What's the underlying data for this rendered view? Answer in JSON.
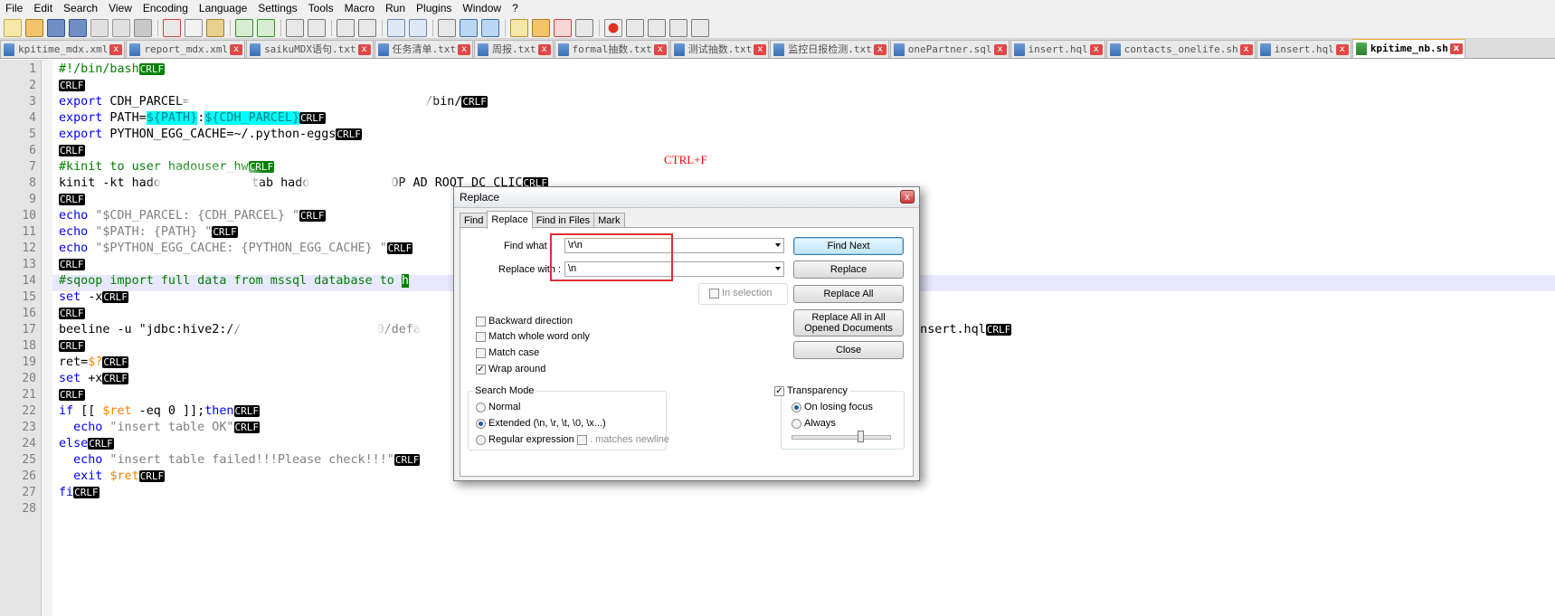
{
  "menu": [
    "File",
    "Edit",
    "Search",
    "View",
    "Encoding",
    "Language",
    "Settings",
    "Tools",
    "Macro",
    "Run",
    "Plugins",
    "Window",
    "?"
  ],
  "tabs": [
    {
      "label": "kpitime_mdx.xml",
      "active": false
    },
    {
      "label": "report_mdx.xml",
      "active": false
    },
    {
      "label": "saikuMDX语句.txt",
      "active": false
    },
    {
      "label": "任务清单.txt",
      "active": false
    },
    {
      "label": "周报.txt",
      "active": false
    },
    {
      "label": "formal抽数.txt",
      "active": false
    },
    {
      "label": "测试抽数.txt",
      "active": false
    },
    {
      "label": "监控日报检测.txt",
      "active": false
    },
    {
      "label": "onePartner.sql",
      "active": false
    },
    {
      "label": "insert.hql",
      "active": false
    },
    {
      "label": "contacts_onelife.sh",
      "active": false
    },
    {
      "label": "insert.hql",
      "active": false
    },
    {
      "label": "kpitime_nb.sh",
      "active": true
    }
  ],
  "line_numbers": [
    "1",
    "2",
    "3",
    "4",
    "5",
    "6",
    "7",
    "8",
    "9",
    "10",
    "11",
    "12",
    "13",
    "14",
    "15",
    "16",
    "17",
    "18",
    "19",
    "20",
    "21",
    "22",
    "23",
    "24",
    "25",
    "26",
    "27",
    "28"
  ],
  "code": {
    "eol": "CRLF",
    "l1": "#!/bin/bash",
    "l3a": "export",
    "l3b": " CDH_PARCEL=",
    "l3c": "/bin/",
    "l4a": "export",
    "l4b": " PATH=",
    "l4c": "${PATH}",
    "l4d": ":",
    "l4e": "${CDH_PARCEL}",
    "l5a": "export",
    "l5b": " PYTHON_EGG_CACHE=~/.python-eggs",
    "l7": "#kinit to user hadouser_hw",
    "l8a": "kinit -kt hado",
    "l8b": "tab hado",
    "l8c": "OP AD ROOT DC CLIC",
    "l10a": "echo",
    "l10b": " \"$CDH_PARCEL: {CDH_PARCEL} \"",
    "l11a": "echo",
    "l11b": " \"$PATH: {PATH} \"",
    "l12a": "echo",
    "l12b": " \"$PYTHON_EGG_CACHE: {PYTHON_EGG_CACHE} \"",
    "l14a": "#sqoop import full data from mssql database to ",
    "l14b": "h",
    "l15a": "set",
    "l15b": " -x",
    "l17a": "beeline -u \"jdbc:hive2://",
    "l17b": "0/defa",
    "l17c": "-f insert.hql",
    "l19a": "ret=",
    "l19b": "$?",
    "l20a": "set",
    "l20b": " +x",
    "l22a": "if",
    "l22b": " [[ ",
    "l22c": "$ret",
    "l22d": " -eq 0 ]];",
    "l22e": "then",
    "l23a": "  ",
    "l23b": "echo",
    "l23c": " \"insert table OK\"",
    "l24": "else",
    "l25a": "  ",
    "l25b": "echo",
    "l25c": " \"insert table failed!!!Please check!!!\"",
    "l26a": "  ",
    "l26b": "exit",
    "l26c": " ",
    "l26d": "$ret",
    "l27": "fi"
  },
  "annotation": "CTRL+F",
  "dialog": {
    "title": "Replace",
    "tabs": [
      "Find",
      "Replace",
      "Find in Files",
      "Mark"
    ],
    "active_tab": "Replace",
    "find_label": "Find what :",
    "find_value": "\\r\\n",
    "replace_label": "Replace with :",
    "replace_value": "\\n",
    "in_selection": "In selection",
    "buttons": {
      "find_next": "Find Next",
      "replace": "Replace",
      "replace_all": "Replace All",
      "replace_all_docs": "Replace All in All Opened Documents",
      "close": "Close"
    },
    "options": {
      "backward": {
        "label": "Backward direction",
        "checked": false
      },
      "whole_word": {
        "label": "Match whole word only",
        "checked": false
      },
      "match_case": {
        "label": "Match case",
        "checked": false
      },
      "wrap_around": {
        "label": "Wrap around",
        "checked": true
      }
    },
    "search_mode": {
      "title": "Search Mode",
      "normal": "Normal",
      "extended": "Extended (\\n, \\r, \\t, \\0, \\x...)",
      "regex": "Regular expression",
      "matches_newline": ". matches newline",
      "selected": "extended"
    },
    "transparency": {
      "label": "Transparency",
      "checked": true,
      "on_losing_focus": "On losing focus",
      "always": "Always",
      "selected": "on_losing_focus",
      "level": 0.68
    },
    "close_glyph": "x"
  },
  "colors": {
    "keyword": "#0000ff",
    "comment": "#008000",
    "variable": "#ff8000",
    "highlight": "#00ffff",
    "annotation": "#ff0000"
  }
}
